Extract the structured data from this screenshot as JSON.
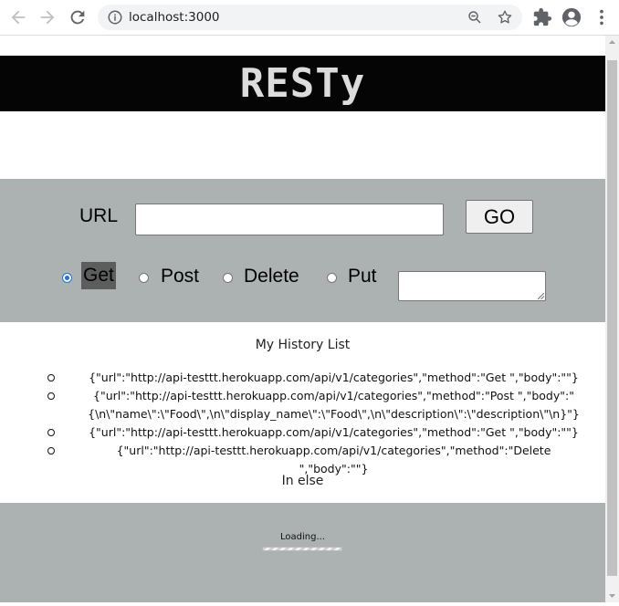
{
  "browser": {
    "url": "localhost:3000"
  },
  "app": {
    "title": "RESTy"
  },
  "form": {
    "url_label": "URL",
    "url_value": "",
    "go_label": "GO",
    "methods": [
      {
        "label": "Get",
        "checked": true
      },
      {
        "label": "Post",
        "checked": false
      },
      {
        "label": "Delete",
        "checked": false
      },
      {
        "label": "Put",
        "checked": false
      }
    ],
    "body_value": ""
  },
  "history": {
    "title": "My History List",
    "items": [
      "{\"url\":\"http://api-testtt.herokuapp.com/api/v1/categories\",\"method\":\"Get \",\"body\":\"\"}",
      "{\"url\":\"http://api-testtt.herokuapp.com/api/v1/categories\",\"method\":\"Post \",\"body\":\"{\\n\\\"name\\\":\\\"Food\\\",\\n\\\"display_name\\\":\\\"Food\\\",\\n\\\"description\\\":\\\"description\\\"\\n}\"}",
      "{\"url\":\"http://api-testtt.herokuapp.com/api/v1/categories\",\"method\":\"Get \",\"body\":\"\"}",
      "{\"url\":\"http://api-testtt.herokuapp.com/api/v1/categories\",\"method\":\"Delete \",\"body\":\"\"}"
    ]
  },
  "status": {
    "else_text": "In else",
    "loading_text": "Loading...",
    "loading_progress": 1.0
  },
  "colors": {
    "header_bg": "#050505",
    "panel_bg": "#acb1b1",
    "selected_label_bg": "#5c5e5e"
  },
  "icons": {
    "back": "arrow-left-icon",
    "forward": "arrow-right-icon",
    "reload": "reload-icon",
    "info": "info-icon",
    "zoom": "zoom-icon",
    "bookmark": "star-icon",
    "extensions": "puzzle-icon",
    "profile": "account-icon",
    "menu": "kebab-menu-icon"
  }
}
